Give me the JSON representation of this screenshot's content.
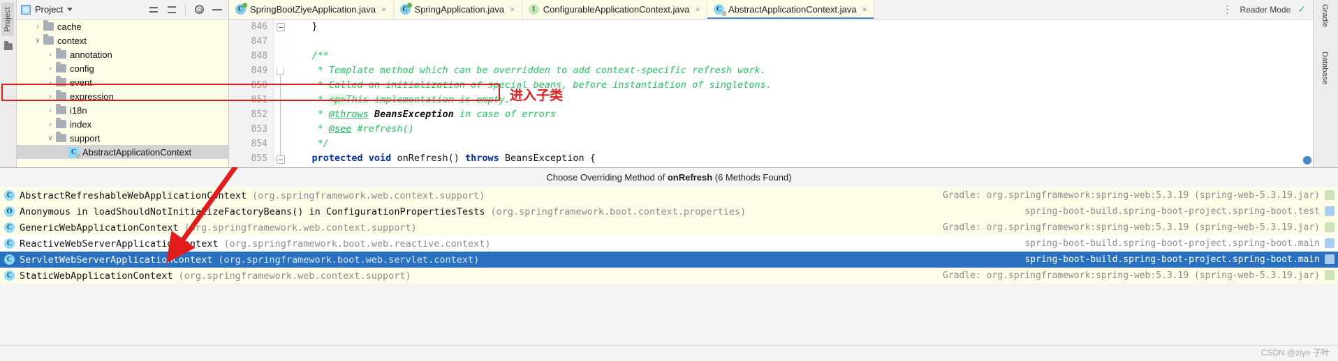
{
  "left_strip": {
    "project_label": "Project",
    "folder_icon": "folder-icon"
  },
  "project_panel": {
    "header": {
      "title": "Project",
      "dropdown_icon": "chevron-down-icon",
      "panel_icon": "project-panel-icon",
      "expand_all_icon": "expand-all-icon",
      "collapse_all_icon": "collapse-all-icon",
      "settings_icon": "gear-icon",
      "hide_icon": "minimize-icon"
    },
    "tree": [
      {
        "label": "cache",
        "indent": 1,
        "twisty": "›",
        "icon": "folder-icon",
        "selected": false
      },
      {
        "label": "context",
        "indent": 1,
        "twisty": "⌄",
        "icon": "folder-icon",
        "selected": false
      },
      {
        "label": "annotation",
        "indent": 2,
        "twisty": "›",
        "icon": "folder-icon",
        "selected": false
      },
      {
        "label": "config",
        "indent": 2,
        "twisty": "›",
        "icon": "folder-icon",
        "selected": false
      },
      {
        "label": "event",
        "indent": 2,
        "twisty": "›",
        "icon": "folder-icon",
        "selected": false
      },
      {
        "label": "expression",
        "indent": 2,
        "twisty": "›",
        "icon": "folder-icon",
        "selected": false
      },
      {
        "label": "i18n",
        "indent": 2,
        "twisty": "›",
        "icon": "folder-icon",
        "selected": false
      },
      {
        "label": "index",
        "indent": 2,
        "twisty": "›",
        "icon": "folder-icon",
        "selected": false
      },
      {
        "label": "support",
        "indent": 2,
        "twisty": "⌄",
        "icon": "folder-icon",
        "selected": false
      },
      {
        "label": "AbstractApplicationContext",
        "indent": 3,
        "twisty": "",
        "icon": "java-class-icon",
        "selected": true
      }
    ]
  },
  "tabs": [
    {
      "label": "SpringBootZiyeApplication.java",
      "icon": "spring-boot-class-icon",
      "active": false,
      "close": "×"
    },
    {
      "label": "SpringApplication.java",
      "icon": "spring-class-icon",
      "active": false,
      "close": "×"
    },
    {
      "label": "ConfigurableApplicationContext.java",
      "icon": "java-interface-icon",
      "active": false,
      "close": "×"
    },
    {
      "label": "AbstractApplicationContext.java",
      "icon": "java-class-readonly-icon",
      "active": true,
      "close": "×"
    }
  ],
  "tabbar_right": {
    "more_icon": "kebab-menu-icon",
    "reader_mode": "Reader Mode",
    "inspection_ok_icon": "checkmark-icon",
    "inspection_ok": "✓"
  },
  "editor": {
    "line_numbers": [
      "846",
      "847",
      "848",
      "849",
      "850",
      "851",
      "852",
      "853",
      "854",
      "855"
    ],
    "lines": [
      {
        "num": "846",
        "segments": [
          {
            "text": "    }",
            "cls": "c-plain"
          }
        ]
      },
      {
        "num": "847",
        "segments": [
          {
            "text": "",
            "cls": "c-plain"
          }
        ]
      },
      {
        "num": "848",
        "segments": [
          {
            "text": "    /**",
            "cls": "c-comment"
          }
        ]
      },
      {
        "num": "849",
        "segments": [
          {
            "text": "     * Template method which can be overridden to add context-specific refresh work.",
            "cls": "c-comment"
          }
        ]
      },
      {
        "num": "850",
        "segments": [
          {
            "text": "     * Called on initialization of special beans, before instantiation of singletons.",
            "cls": "c-comment"
          }
        ]
      },
      {
        "num": "851",
        "segments": [
          {
            "text": "     * ",
            "cls": "c-comment"
          },
          {
            "text": "<p>",
            "cls": "c-html"
          },
          {
            "text": "This implementation is empty.",
            "cls": "c-comment"
          }
        ]
      },
      {
        "num": "852",
        "segments": [
          {
            "text": "     * ",
            "cls": "c-comment"
          },
          {
            "text": "@throws",
            "cls": "c-tag"
          },
          {
            "text": " ",
            "cls": "c-comment"
          },
          {
            "text": "BeansException",
            "cls": "c-bold"
          },
          {
            "text": " in case of errors",
            "cls": "c-comment"
          }
        ]
      },
      {
        "num": "853",
        "segments": [
          {
            "text": "     * ",
            "cls": "c-comment"
          },
          {
            "text": "@see",
            "cls": "c-tag"
          },
          {
            "text": " #refresh()",
            "cls": "c-comment"
          }
        ]
      },
      {
        "num": "854",
        "segments": [
          {
            "text": "     */",
            "cls": "c-comment"
          }
        ]
      },
      {
        "num": "855",
        "segments": [
          {
            "text": "    ",
            "cls": "c-plain"
          },
          {
            "text": "protected void ",
            "cls": "c-kw"
          },
          {
            "text": "onRefresh",
            "cls": "c-ident"
          },
          {
            "text": "() ",
            "cls": "c-plain"
          },
          {
            "text": "throws ",
            "cls": "c-kw"
          },
          {
            "text": "BeansException {",
            "cls": "c-plain"
          }
        ]
      }
    ]
  },
  "right_strip": {
    "gradle": "Gradle",
    "database": "Database"
  },
  "popup": {
    "title_prefix": "Choose Overriding Method of ",
    "title_method": "onRefresh",
    "title_suffix": " (6 Methods Found)",
    "rows": [
      {
        "icon": "java-class-icon",
        "name": "AbstractRefreshableWebApplicationContext",
        "package": "(org.springframework.web.context.support)",
        "location": "Gradle: org.springframework:spring-web:5.3.19 (spring-web-5.3.19.jar)",
        "location_icon": "library-icon",
        "selected": false,
        "stripe": "odd"
      },
      {
        "icon": "anonymous-class-icon",
        "name": "Anonymous in loadShouldNotInitializeFactoryBeans() in ConfigurationPropertiesTests",
        "package": "(org.springframework.boot.context.properties)",
        "location": "spring-boot-build.spring-boot-project.spring-boot.test",
        "location_icon": "module-test-icon",
        "selected": false,
        "stripe": "odd"
      },
      {
        "icon": "java-class-icon",
        "name": "GenericWebApplicationContext",
        "package": "(org.springframework.web.context.support)",
        "location": "Gradle: org.springframework:spring-web:5.3.19 (spring-web-5.3.19.jar)",
        "location_icon": "library-icon",
        "selected": false,
        "stripe": "odd"
      },
      {
        "icon": "java-class-icon",
        "name": "ReactiveWebServerApplicationContext",
        "package": "(org.springframework.boot.web.reactive.context)",
        "location": "spring-boot-build.spring-boot-project.spring-boot.main",
        "location_icon": "module-icon",
        "selected": false,
        "stripe": "even"
      },
      {
        "icon": "java-class-icon",
        "name": "ServletWebServerApplicationContext",
        "package": "(org.springframework.boot.web.servlet.context)",
        "location": "spring-boot-build.spring-boot-project.spring-boot.main",
        "location_icon": "module-icon",
        "selected": true,
        "stripe": "selected"
      },
      {
        "icon": "java-class-icon",
        "name": "StaticWebApplicationContext",
        "package": "(org.springframework.web.context.support)",
        "location": "Gradle: org.springframework:spring-web:5.3.19 (spring-web-5.3.19.jar)",
        "location_icon": "library-icon",
        "selected": false,
        "stripe": "odd"
      }
    ]
  },
  "annotation": {
    "text": "进入子类",
    "color": "#e21b1b",
    "arrow_icon": "red-arrow-icon",
    "box_icon": "red-highlight-box"
  },
  "watermark": "CSDN @ziye 子叶",
  "colors": {
    "selection_blue": "#2a70c0",
    "annotation_red": "#e21b1b",
    "panel_yellow": "#fdfde7",
    "comment_green": "#22c55e",
    "keyword_blue": "#0033b3"
  }
}
